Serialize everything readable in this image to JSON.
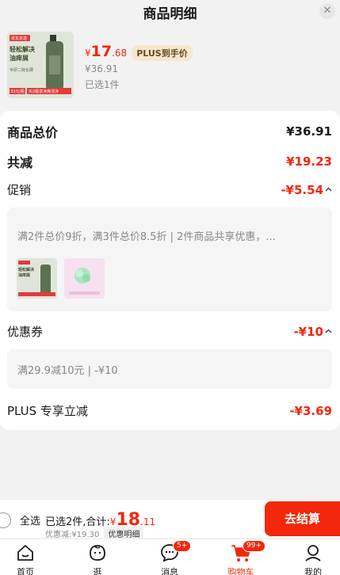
{
  "header": {
    "title": "商品明细",
    "close_icon": "close-icon"
  },
  "product": {
    "thumb_label_top": "京东京造",
    "thumb_label_main": "轻松解决\n油痒屑",
    "thumb_label_sub": "专研二硫化硒",
    "thumb_badge": "33元/瓶",
    "thumb_footer": "买2瓶享净爽洁净",
    "price_symbol": "¥",
    "price_int": "17",
    "price_dec": ".68",
    "plus_tag": "PLUS到手价",
    "original_price": "¥36.91",
    "selected": "已选1件"
  },
  "details": {
    "total_label": "商品总价",
    "total_value": "¥36.91",
    "reduce_label": "共减",
    "reduce_value": "¥19.23",
    "promo_label": "促销",
    "promo_value": "-¥5.54",
    "promo_text": "满2件总价9折，满3件总价8.5折 | 2件商品共享优惠，...",
    "coupon_label": "优惠券",
    "coupon_value": "-¥10",
    "coupon_text": "满29.9减10元 | -¥10",
    "plus_label": "PLUS 专享立减",
    "plus_value": "-¥3.69"
  },
  "checkout": {
    "select_all": "全选",
    "summary_prefix": "已选2件,合计:",
    "total_symbol": "¥",
    "total_int": "18",
    "total_dec": ".11",
    "discount_text": "优惠减:¥19.30",
    "detail_tag": "优惠明细",
    "button": "去结算"
  },
  "tabbar": {
    "items": [
      {
        "label": "首页",
        "icon": "home-icon"
      },
      {
        "label": "逛",
        "icon": "browse-icon"
      },
      {
        "label": "消息",
        "icon": "message-icon",
        "badge": "5+"
      },
      {
        "label": "购物车",
        "icon": "cart-icon",
        "badge": "99+",
        "active": true
      },
      {
        "label": "我的",
        "icon": "profile-icon"
      }
    ]
  },
  "colors": {
    "accent": "#f2270c",
    "plus_gold": "#f5e7cf"
  }
}
